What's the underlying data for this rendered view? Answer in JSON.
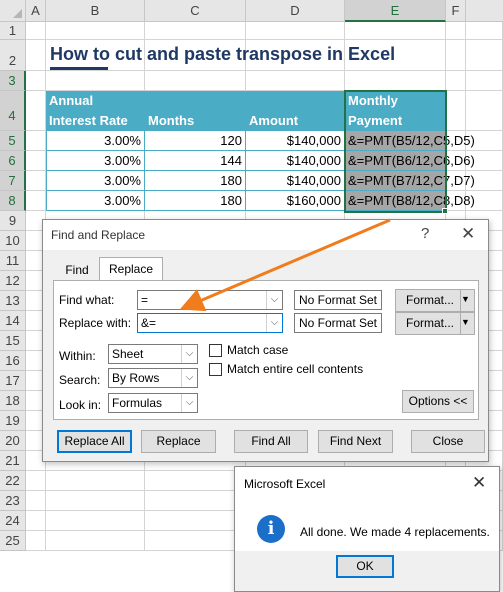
{
  "sheet": {
    "columns": [
      "A",
      "B",
      "C",
      "D",
      "E",
      "F"
    ],
    "rows": [
      "1",
      "2",
      "3",
      "4",
      "5",
      "6",
      "7",
      "8",
      "9",
      "10",
      "11",
      "12",
      "13",
      "14",
      "15",
      "16",
      "17",
      "18",
      "19",
      "20",
      "21",
      "22",
      "23",
      "24",
      "25"
    ],
    "title": "How to cut and paste transpose in Excel",
    "table": {
      "header_top": [
        "Annual",
        "",
        "",
        "Monthly"
      ],
      "header_bottom": [
        "Interest Rate",
        "Months",
        "Amount",
        "Payment"
      ],
      "rows": [
        [
          "3.00%",
          "120",
          "$140,000",
          "&=PMT(B5/12,C5,D5)"
        ],
        [
          "3.00%",
          "144",
          "$140,000",
          "&=PMT(B6/12,C6,D6)"
        ],
        [
          "3.00%",
          "180",
          "$140,000",
          "&=PMT(B7/12,C7,D7)"
        ],
        [
          "3.00%",
          "180",
          "$160,000",
          "&=PMT(B8/12,C8,D8)"
        ]
      ]
    },
    "accent_color": "#4bacc6",
    "selection_color": "#217346",
    "arrow_color": "#f07c1b"
  },
  "find_replace": {
    "title": "Find and Replace",
    "help_icon": "?",
    "close_icon": "✕",
    "tabs": [
      "Find",
      "Replace"
    ],
    "active_tab": "Replace",
    "find_what_label": "Find what:",
    "find_what_value": "=",
    "replace_with_label": "Replace with:",
    "replace_with_value": "&=",
    "no_format_set": "No Format Set",
    "format_button": "Format...",
    "within_label": "Within:",
    "within_value": "Sheet",
    "search_label": "Search:",
    "search_value": "By Rows",
    "look_in_label": "Look in:",
    "look_in_value": "Formulas",
    "match_case": "Match case",
    "match_entire": "Match entire cell contents",
    "options_button": "Options <<",
    "buttons": [
      "Replace All",
      "Replace",
      "Find All",
      "Find Next",
      "Close"
    ]
  },
  "message_box": {
    "title": "Microsoft Excel",
    "close_icon": "✕",
    "icon": "i",
    "message": "All done. We made 4 replacements.",
    "ok_button": "OK"
  }
}
